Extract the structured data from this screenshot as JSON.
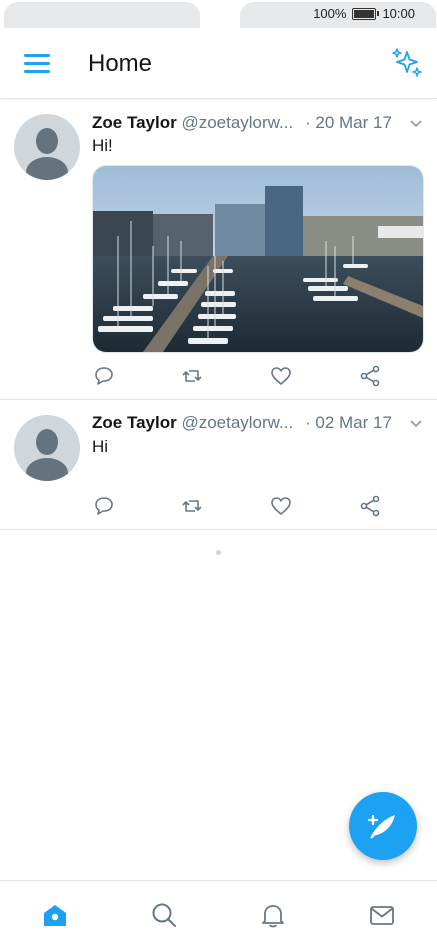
{
  "status": {
    "battery": "100%",
    "time": "10:00"
  },
  "header": {
    "title": "Home"
  },
  "tweets": [
    {
      "name": "Zoe Taylor",
      "handle": "@zoetaylorw...",
      "date": "· 20 Mar 17",
      "text": "Hi!",
      "has_media": true
    },
    {
      "name": "Zoe Taylor",
      "handle": "@zoetaylorw...",
      "date": "· 02 Mar 17",
      "text": "Hi",
      "has_media": false
    }
  ],
  "colors": {
    "accent": "#1da1f2",
    "muted": "#657786",
    "divider": "#e1e8ed"
  },
  "icons": {
    "menu": "menu-icon",
    "sparkle": "sparkle-icon",
    "reply": "reply-icon",
    "retweet": "retweet-icon",
    "like": "heart-icon",
    "share": "share-icon",
    "compose": "compose-icon",
    "home": "home-icon",
    "search": "search-icon",
    "notifications": "bell-icon",
    "messages": "mail-icon"
  }
}
